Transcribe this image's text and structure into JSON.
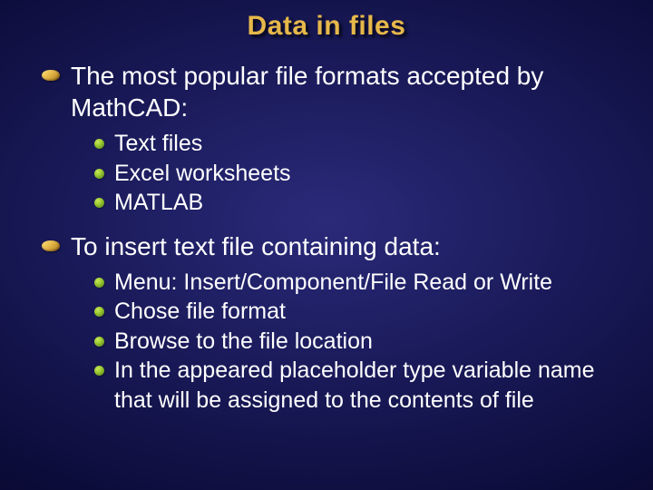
{
  "slide": {
    "title": "Data in files",
    "items": [
      {
        "text": "The most popular file formats accepted by MathCAD:",
        "sub": [
          {
            "text": "Text files"
          },
          {
            "text": "Excel worksheets"
          },
          {
            "text": "MATLAB"
          }
        ]
      },
      {
        "text": "To insert text file containing data:",
        "sub": [
          {
            "text": "Menu: Insert/Component/File Read or Write"
          },
          {
            "text": "Chose file format"
          },
          {
            "text": "Browse to the file location"
          },
          {
            "text": "In the appeared placeholder type variable name that will be assigned to the contents of file"
          }
        ]
      }
    ]
  }
}
